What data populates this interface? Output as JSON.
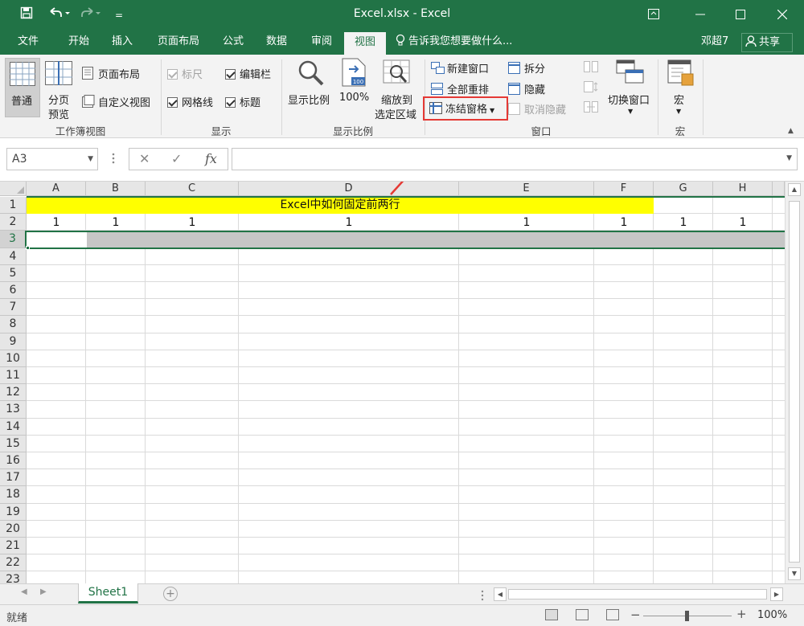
{
  "titlebar": {
    "title": "Excel.xlsx - Excel",
    "qa_customize": "="
  },
  "tabs": [
    {
      "label": "文件"
    },
    {
      "label": "开始"
    },
    {
      "label": "插入"
    },
    {
      "label": "页面布局"
    },
    {
      "label": "公式"
    },
    {
      "label": "数据"
    },
    {
      "label": "审阅"
    },
    {
      "label": "视图"
    }
  ],
  "active_tab": "视图",
  "tellme": "告诉我您想要做什么...",
  "user": "邓超7",
  "share_label": "共享",
  "ribbon": {
    "workbook_views": {
      "label": "工作簿视图",
      "normal": "普通",
      "page_break_1": "分页",
      "page_break_2": "预览",
      "page_layout": "页面布局",
      "custom_views": "自定义视图"
    },
    "show": {
      "label": "显示",
      "ruler": "标尺",
      "formula_bar": "编辑栏",
      "gridlines": "网格线",
      "headings": "标题"
    },
    "zoom": {
      "label": "显示比例",
      "zoom": "显示比例",
      "zoom_100": "100%",
      "zoom_sel_1": "缩放到",
      "zoom_sel_2": "选定区域",
      "icon_100": "100"
    },
    "window": {
      "label": "窗口",
      "new_window": "新建窗口",
      "arrange_all": "全部重排",
      "freeze_panes": "冻结窗格",
      "split": "拆分",
      "hide": "隐藏",
      "unhide": "取消隐藏",
      "switch_windows": "切换窗口"
    },
    "macros": {
      "label": "宏",
      "macros": "宏"
    }
  },
  "formula_bar": {
    "name_box": "A3",
    "fx": "fx",
    "value": ""
  },
  "grid": {
    "columns": [
      "A",
      "B",
      "C",
      "D",
      "E",
      "F",
      "G",
      "H"
    ],
    "rows": [
      "1",
      "2",
      "3",
      "4",
      "5",
      "6",
      "7",
      "8",
      "9",
      "10",
      "11",
      "12",
      "13",
      "14",
      "15",
      "16",
      "17",
      "18",
      "19",
      "20",
      "21",
      "22",
      "23"
    ],
    "merged_title": "Excel中如何固定前两行",
    "row2_values": [
      "1",
      "1",
      "1",
      "1",
      "1",
      "1",
      "1",
      "1"
    ],
    "selected_row": "3",
    "highlight_color": "#ffff00",
    "accent_color": "#217346",
    "annotation_color": "#e53935"
  },
  "sheets": {
    "tabs": [
      "Sheet1"
    ],
    "add": "+"
  },
  "statusbar": {
    "ready": "就绪",
    "zoom": "100%",
    "minus": "−",
    "plus": "+"
  }
}
